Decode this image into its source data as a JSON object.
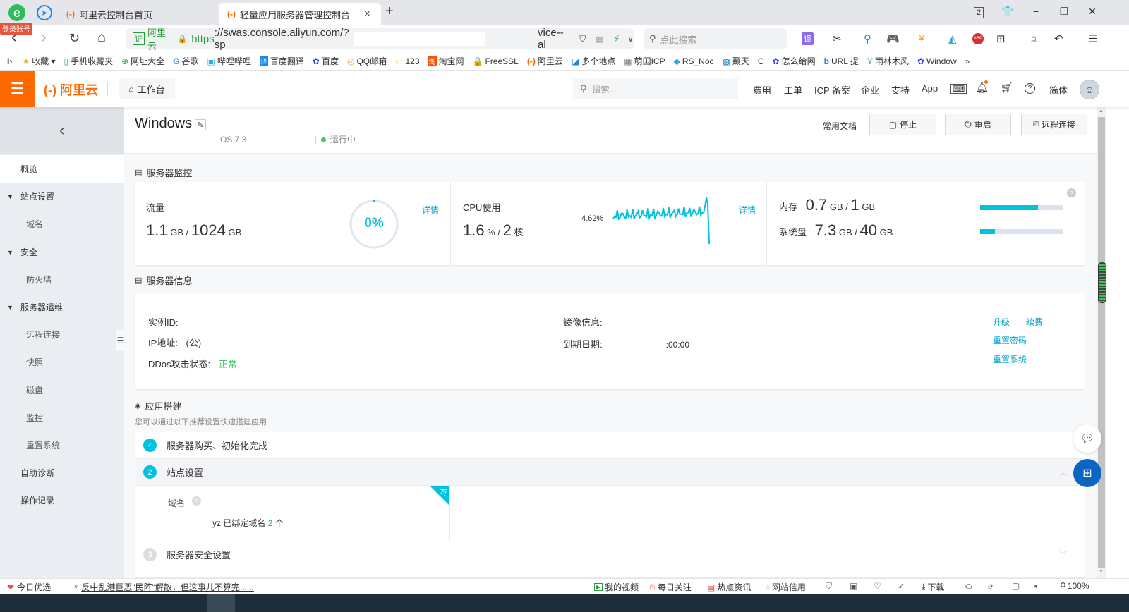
{
  "browser": {
    "login_badge": "登录账号",
    "tabs": [
      {
        "label": "阿里云控制台首页",
        "active": false
      },
      {
        "label": "轻量应用服务器管理控制台",
        "active": true
      }
    ],
    "tab_close": "×",
    "new_tab": "+",
    "window_controls": {
      "tab_count": "2",
      "skin": "👕",
      "minimize": "−",
      "restore": "❐",
      "close": "✕"
    },
    "nav": {
      "back": "‹",
      "forward": "›",
      "reload": "↻",
      "home": "⌂"
    },
    "url": {
      "cert_badge": "证",
      "site_name": "阿里云",
      "lock": "🔒",
      "scheme": "https",
      "host": "://swas.console.aliyun.com/?sp",
      "tail": "vice--al"
    },
    "search_placeholder": "点此搜索",
    "bookmarks": [
      {
        "icon": "★",
        "label": "收藏 ▾"
      },
      {
        "icon": "▯",
        "label": "手机收藏夹"
      },
      {
        "icon": "⊕",
        "label": "网址大全"
      },
      {
        "icon": "G",
        "label": "谷歌"
      },
      {
        "icon": "▣",
        "label": "哔哩哔哩"
      },
      {
        "icon": "译",
        "label": "百度翻译"
      },
      {
        "icon": "✿",
        "label": "百度"
      },
      {
        "icon": "◎",
        "label": "QQ邮箱"
      },
      {
        "icon": "▭",
        "label": "123"
      },
      {
        "icon": "淘",
        "label": "淘宝网"
      },
      {
        "icon": "🔒",
        "label": "FreeSSL"
      },
      {
        "icon": "(-)",
        "label": "阿里云"
      },
      {
        "icon": "◪",
        "label": "多个地点"
      },
      {
        "icon": "▦",
        "label": "萌国ICP"
      },
      {
        "icon": "◆",
        "label": "RS_Noc"
      },
      {
        "icon": "▩",
        "label": "颞天－C"
      },
      {
        "icon": "✿",
        "label": "怎么给网"
      },
      {
        "icon": "b",
        "label": "URL 提"
      },
      {
        "icon": "Y",
        "label": "雨林木风"
      },
      {
        "icon": "✿",
        "label": "Window"
      }
    ],
    "bookmarks_more": "»"
  },
  "console": {
    "logo": "(-) 阿里云",
    "workbench": "工作台",
    "search_placeholder": "搜索...",
    "nav": [
      "费用",
      "工单",
      "ICP 备案",
      "企业",
      "支持",
      "App"
    ],
    "lang": "简体"
  },
  "sidebar": {
    "back": "‹",
    "items": [
      {
        "label": "概览",
        "level": 1,
        "active": true,
        "expandable": false
      },
      {
        "label": "站点设置",
        "level": 1,
        "expandable": true
      },
      {
        "label": "域名",
        "level": 2
      },
      {
        "label": "安全",
        "level": 1,
        "expandable": true
      },
      {
        "label": "防火墙",
        "level": 2
      },
      {
        "label": "服务器运维",
        "level": 1,
        "expandable": true
      },
      {
        "label": "远程连接",
        "level": 2
      },
      {
        "label": "快照",
        "level": 2
      },
      {
        "label": "磁盘",
        "level": 2
      },
      {
        "label": "监控",
        "level": 2
      },
      {
        "label": "重置系统",
        "level": 2
      },
      {
        "label": "自助诊断",
        "level": 1
      },
      {
        "label": "操作记录",
        "level": 1
      }
    ]
  },
  "instance": {
    "title": "Windows",
    "os": "OS 7.3",
    "status": "运行中",
    "status_color": "#44c46a",
    "actions": {
      "docs": "常用文档",
      "stop": "停止",
      "restart": "重启",
      "remote": "远程连接"
    }
  },
  "monitor": {
    "section_title": "服务器监控",
    "traffic": {
      "label": "流量",
      "used": "1.1",
      "used_unit": "GB",
      "total": "1024",
      "total_unit": "GB",
      "percent": "0%",
      "percent_value": 0,
      "detail": "详情"
    },
    "cpu": {
      "label": "CPU使用",
      "used": "1.6",
      "used_unit": "%",
      "cores": "2",
      "cores_unit": "核",
      "peak": "4.62%",
      "detail": "详情"
    },
    "memory": {
      "label": "内存",
      "used": "0.7",
      "used_unit": "GB",
      "total": "1",
      "total_unit": "GB",
      "fraction": 0.7
    },
    "disk": {
      "label": "系统盘",
      "used": "7.3",
      "used_unit": "GB",
      "total": "40",
      "total_unit": "GB",
      "fraction": 0.1825
    },
    "help": "?",
    "accent": "#00c1de"
  },
  "server_info": {
    "section_title": "服务器信息",
    "instance_id_label": "实例ID:",
    "ip_label": "IP地址:",
    "ip_value": "(公)",
    "ddos_label": "DDos攻击状态:",
    "ddos_value": "正常",
    "image_label": "镜像信息:",
    "expiry_label": "到期日期:",
    "expiry_value": ":00:00",
    "links": {
      "upgrade": "升级",
      "renew": "续费",
      "reset_password": "重置密码",
      "reset_system": "重置系统"
    }
  },
  "app_build": {
    "section_title": "应用搭建",
    "subtitle": "您可以通过以下推荐设置快速搭建应用",
    "steps": [
      {
        "badge": "✓",
        "label": "服务器购买、初始化完成",
        "state": "done"
      },
      {
        "badge": "2",
        "label": "站点设置",
        "state": "active"
      },
      {
        "badge": "3",
        "label": "服务器安全设置",
        "state": "pending"
      }
    ],
    "domain_label": "域名",
    "domain_text_prefix": "yz 已绑定域名",
    "domain_count": "2",
    "domain_text_suffix": "个",
    "recommend_tag": "荐"
  },
  "statusbar": {
    "today": "今日优选",
    "news": "反中乱港巨恶\"民阵\"解散，但这事儿不算完......",
    "items": [
      "我的视频",
      "每日关注",
      "热点资讯",
      "网站信用",
      "下载"
    ],
    "zoom": "100%"
  }
}
